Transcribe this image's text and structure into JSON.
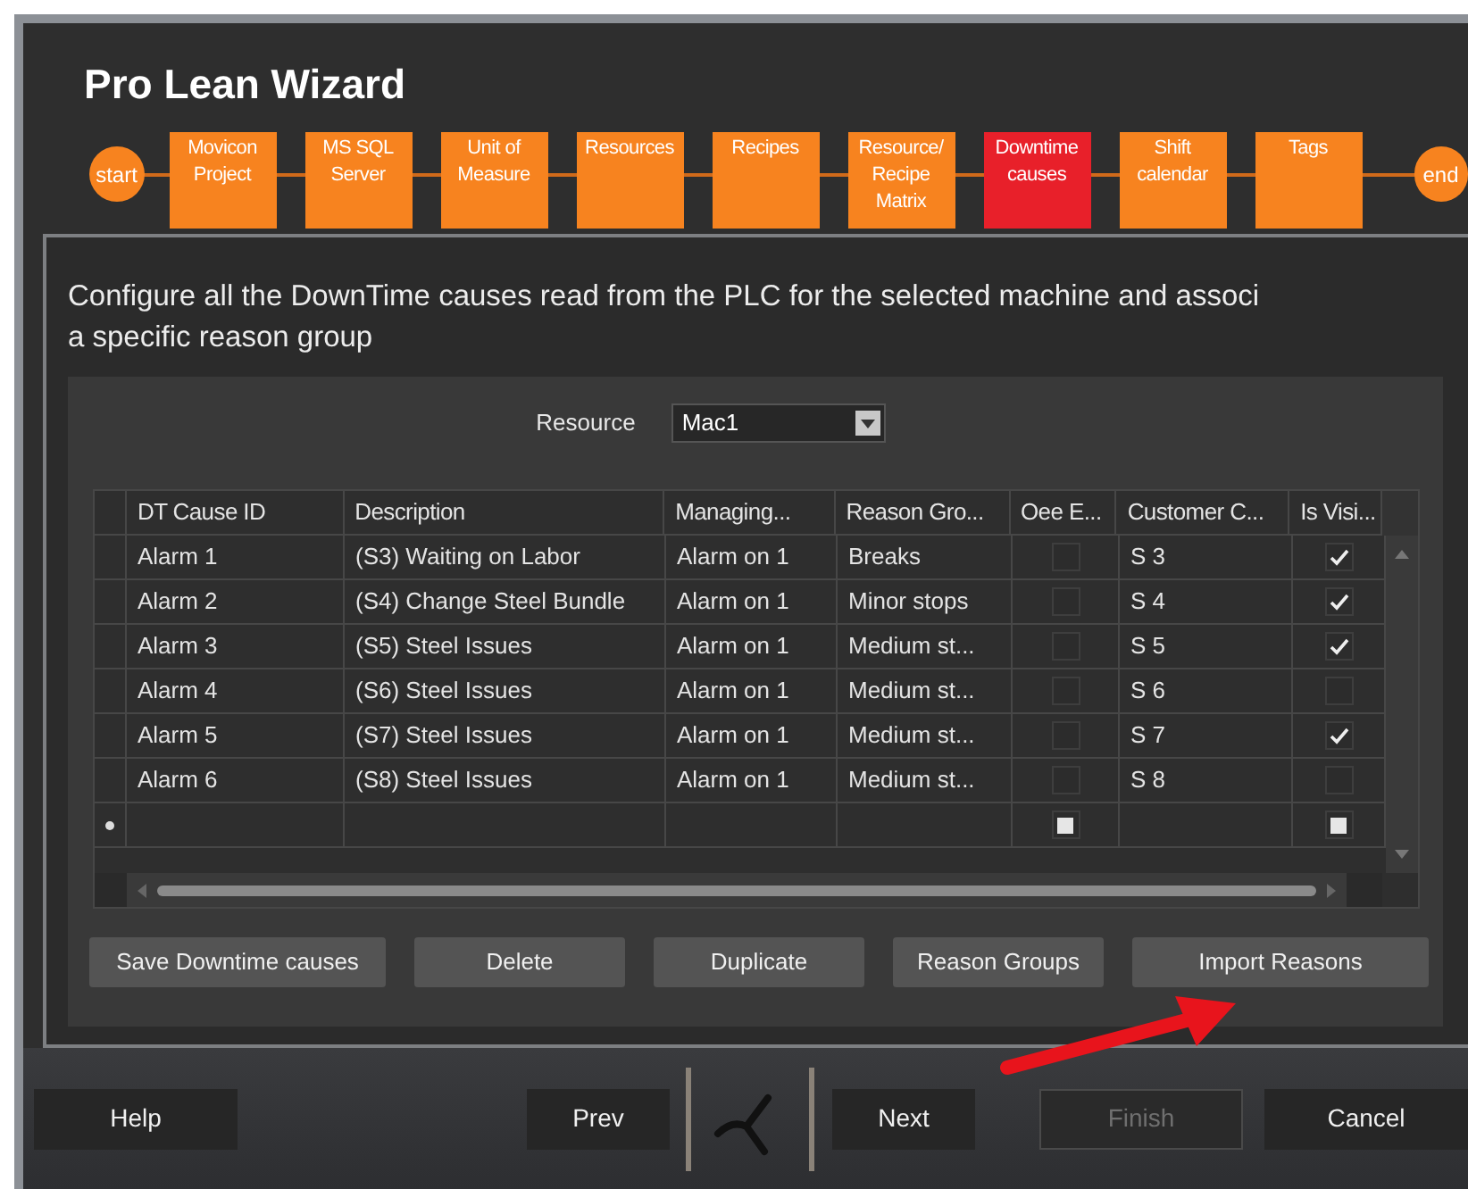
{
  "window": {
    "title": "Pro Lean Wizard"
  },
  "steps": [
    {
      "kind": "circle",
      "label": "start",
      "selected": false
    },
    {
      "kind": "box",
      "label": "Movicon\nProject",
      "selected": false
    },
    {
      "kind": "box",
      "label": "MS SQL\nServer",
      "selected": false
    },
    {
      "kind": "box",
      "label": "Unit of\nMeasure",
      "selected": false
    },
    {
      "kind": "box",
      "label": "Resources",
      "selected": false
    },
    {
      "kind": "box",
      "label": "Recipes",
      "selected": false
    },
    {
      "kind": "box",
      "label": "Resource/\nRecipe\nMatrix",
      "selected": false
    },
    {
      "kind": "box",
      "label": "Downtime\ncauses",
      "selected": true
    },
    {
      "kind": "box",
      "label": "Shift\ncalendar",
      "selected": false
    },
    {
      "kind": "box",
      "label": "Tags",
      "selected": false
    },
    {
      "kind": "circle",
      "label": "end",
      "selected": false
    }
  ],
  "instructions": "Configure all the DownTime causes read from the PLC for the selected machine and associ\na specific reason group",
  "resource": {
    "label": "Resource",
    "value": "Mac1"
  },
  "table": {
    "columns": [
      "DT Cause ID",
      "Description",
      "Managing...",
      "Reason Gro...",
      "Oee E...",
      "Customer C...",
      "Is Visi..."
    ],
    "rows": [
      {
        "id": "Alarm 1",
        "description": "(S3) Waiting on Labor",
        "managing": "Alarm on 1",
        "reason_group": "Breaks",
        "oee": false,
        "customer_code": "S 3",
        "visible": true
      },
      {
        "id": "Alarm 2",
        "description": "(S4) Change Steel Bundle",
        "managing": "Alarm on 1",
        "reason_group": "Minor stops",
        "oee": false,
        "customer_code": "S 4",
        "visible": true
      },
      {
        "id": "Alarm 3",
        "description": "(S5) Steel Issues",
        "managing": "Alarm on 1",
        "reason_group": "Medium st...",
        "oee": false,
        "customer_code": "S 5",
        "visible": true
      },
      {
        "id": "Alarm 4",
        "description": "(S6) Steel Issues",
        "managing": "Alarm on 1",
        "reason_group": "Medium st...",
        "oee": false,
        "customer_code": "S 6",
        "visible": false
      },
      {
        "id": "Alarm 5",
        "description": "(S7) Steel Issues",
        "managing": "Alarm on 1",
        "reason_group": "Medium st...",
        "oee": false,
        "customer_code": "S 7",
        "visible": true
      },
      {
        "id": "Alarm 6",
        "description": "(S8) Steel Issues",
        "managing": "Alarm on 1",
        "reason_group": "Medium st...",
        "oee": false,
        "customer_code": "S 8",
        "visible": false
      }
    ],
    "new_row": {
      "oee_indeterminate": true,
      "visible_indeterminate": true
    }
  },
  "actions": [
    "Save Downtime causes",
    "Delete",
    "Duplicate",
    "Reason Groups",
    "Import Reasons"
  ],
  "footer": {
    "help": {
      "label": "Help",
      "disabled": false
    },
    "prev": {
      "label": "Prev",
      "disabled": false
    },
    "next": {
      "label": "Next",
      "disabled": false
    },
    "finish": {
      "label": "Finish",
      "disabled": true
    },
    "cancel": {
      "label": "Cancel",
      "disabled": false
    }
  }
}
